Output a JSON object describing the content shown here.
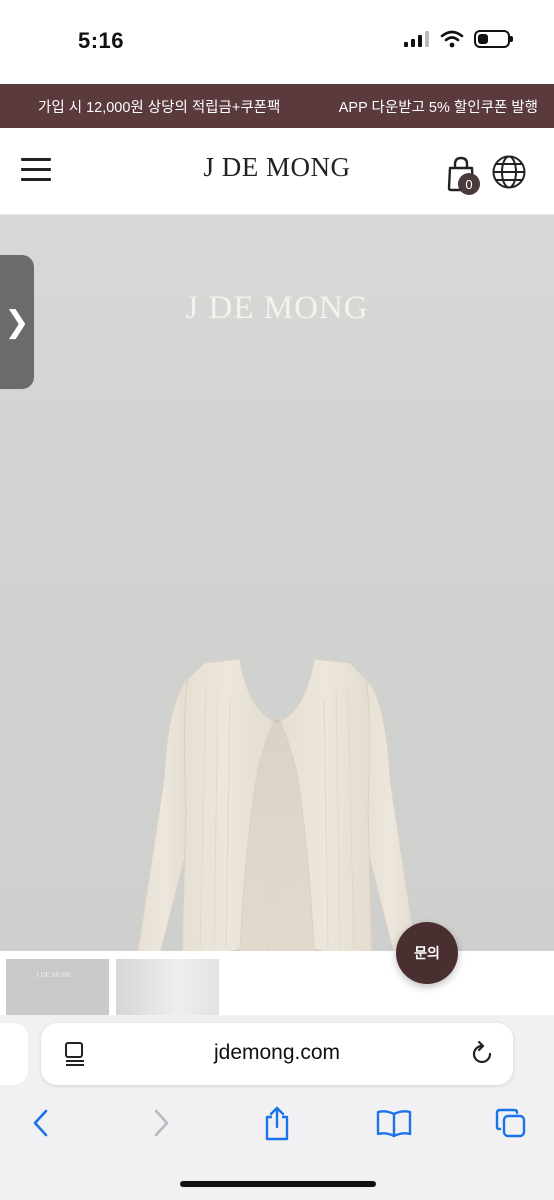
{
  "status_bar": {
    "time": "5:16",
    "battery_level": 0.35
  },
  "promo": {
    "left_text": "가입 시 12,000원 상당의 적립금+쿠폰팩",
    "right_text": "APP 다운받고 5% 할인쿠폰 발행",
    "background": "#5a3a3c"
  },
  "header": {
    "logo": "J DE MONG",
    "cart_count": "0"
  },
  "hero": {
    "logo": "J DE MONG",
    "side_tab_glyph": "❯"
  },
  "thumbnails": {
    "first_label": "J DE MONG"
  },
  "inquiry_label": "문의",
  "browser": {
    "url": "jdemong.com"
  },
  "colors": {
    "accent": "#4a2f31",
    "ios_blue": "#1a73e8"
  },
  "icons": [
    "hamburger-icon",
    "shopping-bag-icon",
    "globe-icon",
    "chevron-right-icon",
    "reader-icon",
    "reload-icon",
    "back-icon",
    "forward-icon",
    "share-icon",
    "bookmarks-icon",
    "tabs-icon"
  ]
}
